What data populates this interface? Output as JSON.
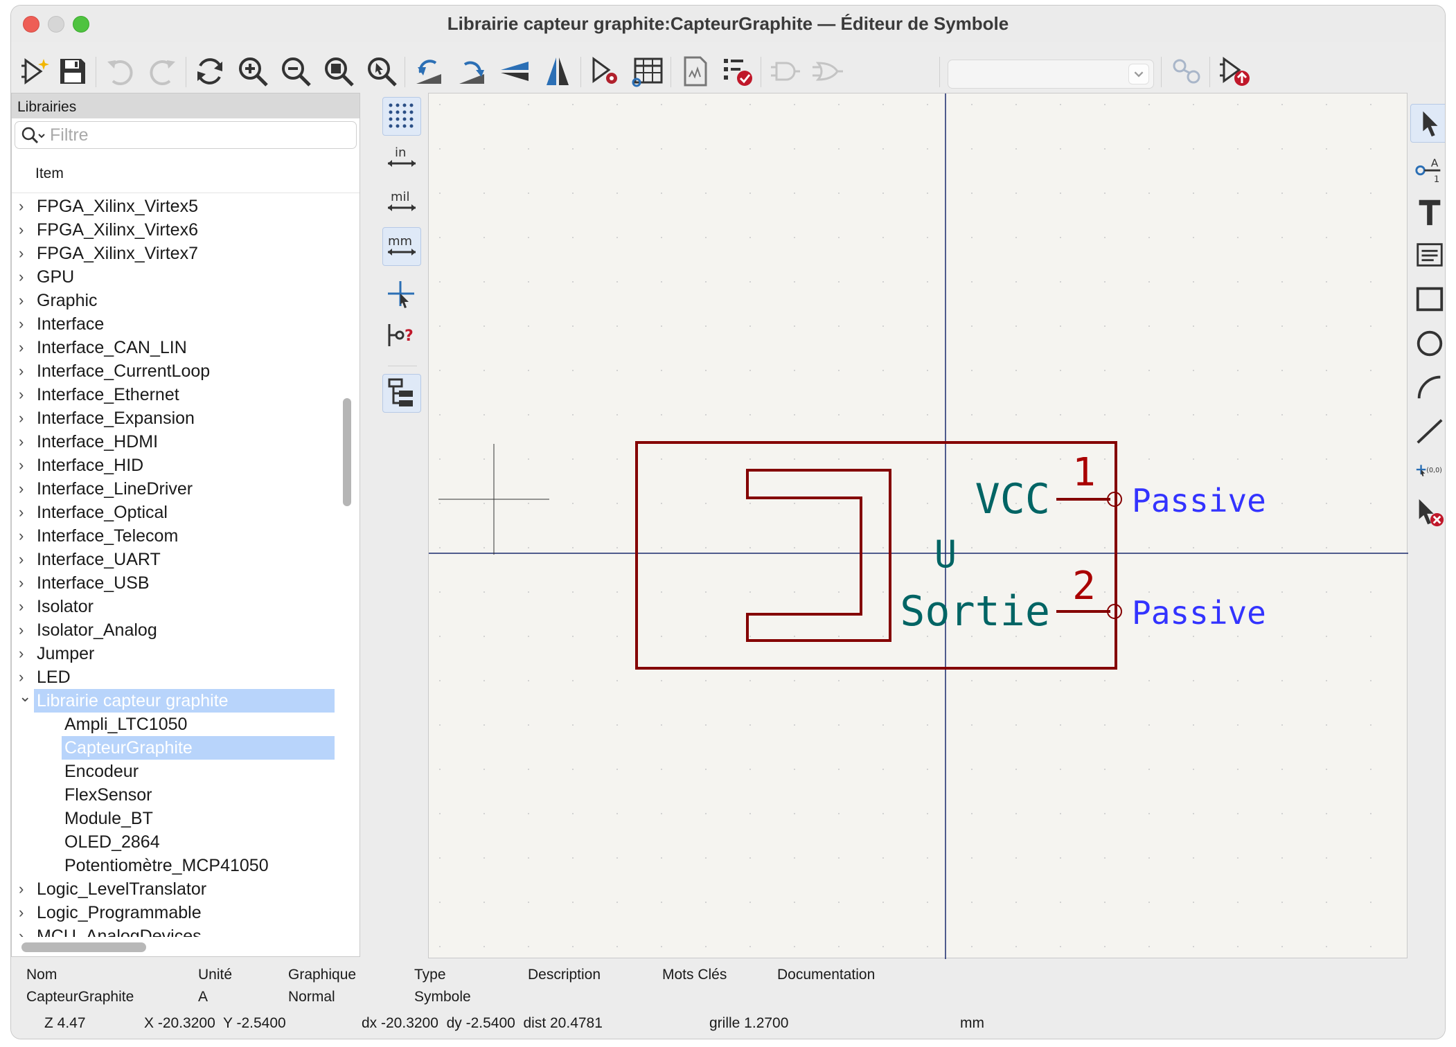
{
  "window": {
    "title": "Librairie capteur graphite:CapteurGraphite — Éditeur de Symbole"
  },
  "toolbar": {
    "buttons": [
      "new-symbol-icon",
      "save-icon",
      "undo-icon",
      "redo-icon",
      "refresh-icon",
      "zoom-in-icon",
      "zoom-out-icon",
      "zoom-fit-icon",
      "zoom-selection-icon",
      "rotate-ccw-icon",
      "rotate-cw-icon",
      "mirror-vertical-icon",
      "mirror-horizontal-icon",
      "symbol-properties-icon",
      "pin-table-icon",
      "datasheet-icon",
      "check-symbol-icon",
      "demorgan-normal-icon",
      "demorgan-alternate-icon",
      "unit-selector",
      "sync-pins-icon",
      "add-symbol-to-schematic-icon"
    ],
    "unit_select_value": ""
  },
  "library_panel": {
    "header": "Librairies",
    "filter_placeholder": "Filtre",
    "column_header": "Item",
    "tree": [
      {
        "label": "FPGA_Xilinx_Virtex5",
        "level": 0,
        "expanded": false
      },
      {
        "label": "FPGA_Xilinx_Virtex6",
        "level": 0,
        "expanded": false
      },
      {
        "label": "FPGA_Xilinx_Virtex7",
        "level": 0,
        "expanded": false
      },
      {
        "label": "GPU",
        "level": 0,
        "expanded": false
      },
      {
        "label": "Graphic",
        "level": 0,
        "expanded": false
      },
      {
        "label": "Interface",
        "level": 0,
        "expanded": false
      },
      {
        "label": "Interface_CAN_LIN",
        "level": 0,
        "expanded": false
      },
      {
        "label": "Interface_CurrentLoop",
        "level": 0,
        "expanded": false
      },
      {
        "label": "Interface_Ethernet",
        "level": 0,
        "expanded": false
      },
      {
        "label": "Interface_Expansion",
        "level": 0,
        "expanded": false
      },
      {
        "label": "Interface_HDMI",
        "level": 0,
        "expanded": false
      },
      {
        "label": "Interface_HID",
        "level": 0,
        "expanded": false
      },
      {
        "label": "Interface_LineDriver",
        "level": 0,
        "expanded": false
      },
      {
        "label": "Interface_Optical",
        "level": 0,
        "expanded": false
      },
      {
        "label": "Interface_Telecom",
        "level": 0,
        "expanded": false
      },
      {
        "label": "Interface_UART",
        "level": 0,
        "expanded": false
      },
      {
        "label": "Interface_USB",
        "level": 0,
        "expanded": false
      },
      {
        "label": "Isolator",
        "level": 0,
        "expanded": false
      },
      {
        "label": "Isolator_Analog",
        "level": 0,
        "expanded": false
      },
      {
        "label": "Jumper",
        "level": 0,
        "expanded": false
      },
      {
        "label": "LED",
        "level": 0,
        "expanded": false
      },
      {
        "label": "Librairie capteur graphite",
        "level": 0,
        "expanded": true,
        "selected": true
      },
      {
        "label": "Ampli_LTC1050",
        "level": 1
      },
      {
        "label": "CapteurGraphite",
        "level": 1,
        "selected": true
      },
      {
        "label": "Encodeur",
        "level": 1
      },
      {
        "label": "FlexSensor",
        "level": 1
      },
      {
        "label": "Module_BT",
        "level": 1
      },
      {
        "label": "OLED_2864",
        "level": 1
      },
      {
        "label": "Potentiomètre_MCP41050",
        "level": 1
      },
      {
        "label": "Logic_LevelTranslator",
        "level": 0,
        "expanded": false
      },
      {
        "label": "Logic_Programmable",
        "level": 0,
        "expanded": false
      },
      {
        "label": "MCU_AnalogDevices",
        "level": 0,
        "expanded": false
      }
    ]
  },
  "left_tools": [
    "grid-toggle-icon",
    "units-inches-icon",
    "units-mils-icon",
    "units-mm-icon",
    "full-crosshair-icon",
    "show-pin-electrical-type-icon",
    "library-tree-toggle-icon"
  ],
  "canvas": {
    "symbol": {
      "reference": "U",
      "pins": [
        {
          "name": "VCC",
          "number": "1",
          "type": "Passive"
        },
        {
          "name": "Sortie",
          "number": "2",
          "type": "Passive"
        }
      ]
    },
    "colors": {
      "background": "#f5f4f0",
      "body": "#840000",
      "pin_name": "#006464",
      "pin_number": "#a90000",
      "pin_type": "#3333ff",
      "axis": "#1a2a6c"
    }
  },
  "right_tools": [
    "select-arrow-icon",
    "add-pin-icon",
    "add-text-icon",
    "add-textbox-icon",
    "add-rectangle-icon",
    "add-circle-icon",
    "add-arc-icon",
    "add-line-icon",
    "anchor-icon",
    "delete-tool-icon"
  ],
  "properties": {
    "columns": [
      {
        "header": "Nom",
        "value": "CapteurGraphite"
      },
      {
        "header": "Unité",
        "value": "A"
      },
      {
        "header": "Graphique",
        "value": "Normal"
      },
      {
        "header": "Type",
        "value": "Symbole"
      },
      {
        "header": "Description",
        "value": ""
      },
      {
        "header": "Mots Clés",
        "value": ""
      },
      {
        "header": "Documentation",
        "value": ""
      }
    ]
  },
  "status": {
    "zoom": "Z 4.47",
    "coords": "X -20.3200  Y -2.5400",
    "delta": "dx -20.3200  dy -2.5400  dist 20.4781",
    "grid": "grille 1.2700",
    "units": "mm"
  }
}
